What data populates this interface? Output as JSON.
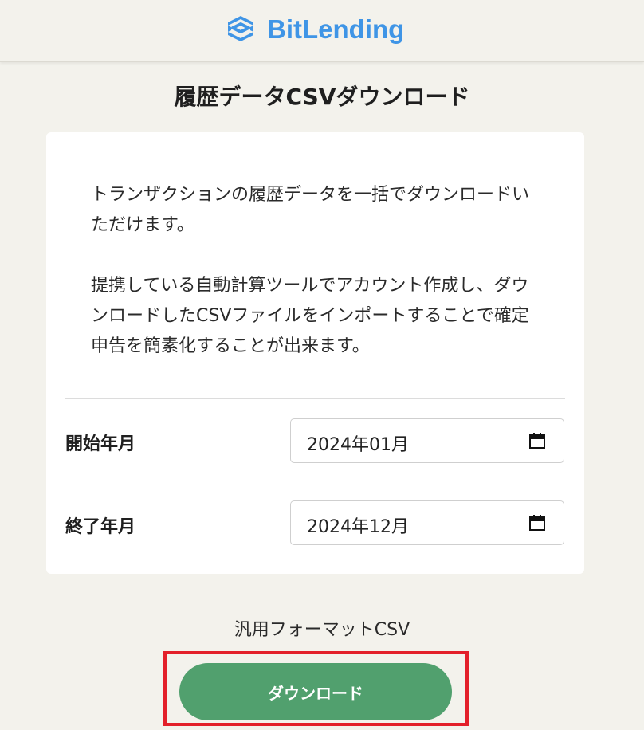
{
  "header": {
    "brand": "BitLending",
    "logo_icon": "bitlending-logo-icon",
    "brand_color": "#3f95e6"
  },
  "page": {
    "title": "履歴データCSVダウンロード"
  },
  "card": {
    "description_1": "トランザクションの履歴データを一括でダウンロードいただけます。",
    "description_2": "提携している自動計算ツールでアカウント作成し、ダウンロードしたCSVファイルをインポートすることで確定申告を簡素化することが出来ます。",
    "start": {
      "label": "開始年月",
      "value": "2024年01月",
      "icon": "calendar-icon"
    },
    "end": {
      "label": "終了年月",
      "value": "2024年12月",
      "icon": "calendar-icon"
    }
  },
  "download": {
    "format_label": "汎用フォーマットCSV",
    "button_label": "ダウンロード",
    "button_color": "#51a06e",
    "highlight_color": "#e3202a"
  }
}
